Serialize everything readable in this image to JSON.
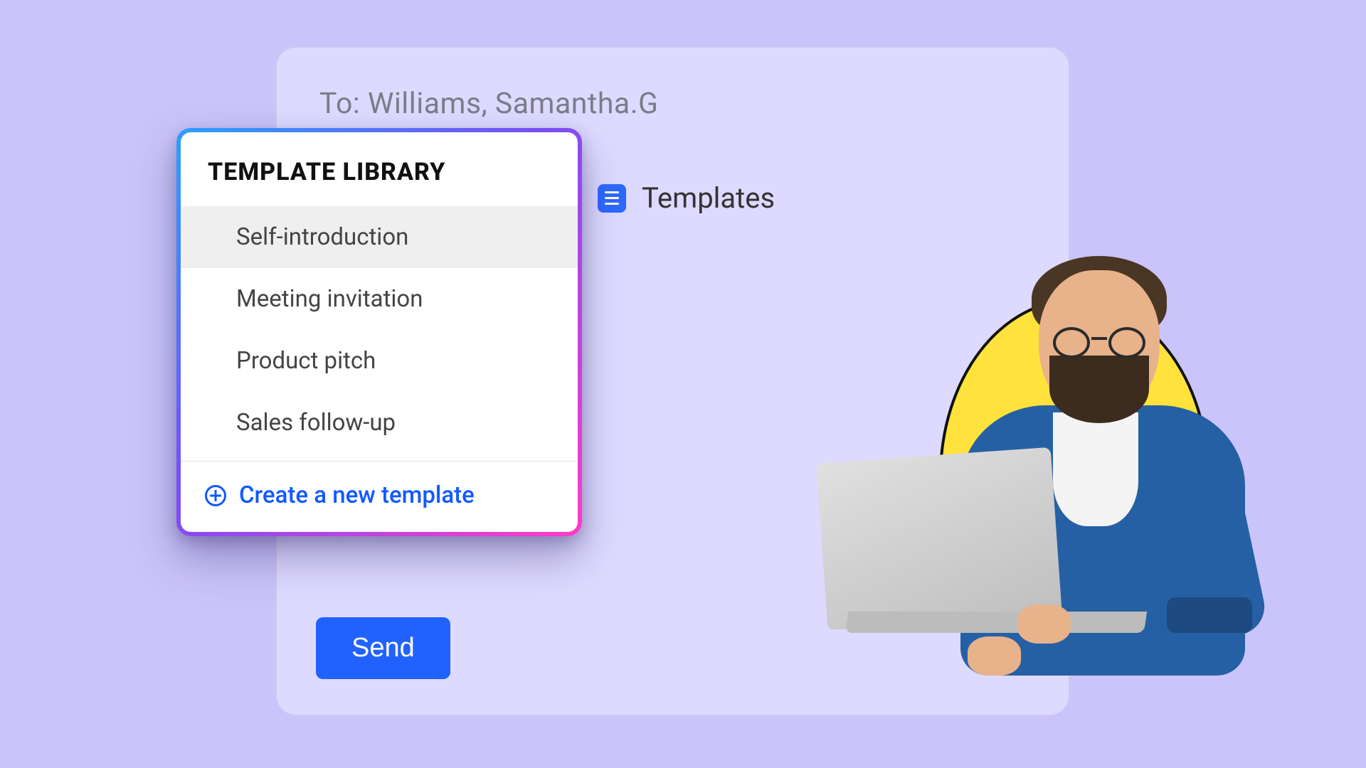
{
  "compose": {
    "to_label": "To: Williams, Samantha.G",
    "templates_label": "Templates",
    "send_label": "Send"
  },
  "template_library": {
    "title": "TEMPLATE LIBRARY",
    "items": [
      {
        "label": "Self-introduction",
        "selected": true
      },
      {
        "label": "Meeting invitation",
        "selected": false
      },
      {
        "label": "Product pitch",
        "selected": false
      },
      {
        "label": "Sales follow-up",
        "selected": false
      }
    ],
    "create_label": "Create a new template"
  }
}
